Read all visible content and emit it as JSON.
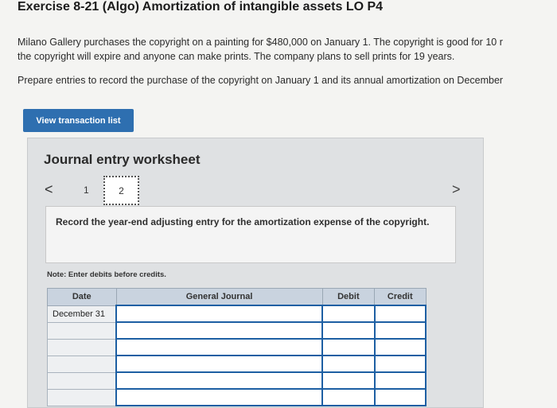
{
  "header": {
    "title": "Exercise 8-21 (Algo) Amortization of intangible assets LO P4"
  },
  "problem": {
    "line1": "Milano Gallery purchases the copyright on a painting for $480,000 on January 1. The copyright is good for 10 r",
    "line2": "the copyright will expire and anyone can make prints. The company plans to sell prints for 19 years.",
    "line3": "Prepare entries to record the purchase of the copyright on January 1 and its annual amortization on December"
  },
  "buttons": {
    "view_transaction_list": "View transaction list"
  },
  "worksheet": {
    "title": "Journal entry worksheet",
    "nav_prev": "<",
    "nav_next": ">",
    "pages": [
      "1",
      "2"
    ],
    "instruction": "Record the year-end adjusting entry for the amortization expense of the copyright.",
    "note": "Note: Enter debits before credits."
  },
  "table": {
    "headers": [
      "Date",
      "General Journal",
      "Debit",
      "Credit"
    ],
    "rows": [
      {
        "date": "December 31"
      },
      {
        "date": ""
      },
      {
        "date": ""
      },
      {
        "date": ""
      },
      {
        "date": ""
      },
      {
        "date": ""
      }
    ]
  }
}
